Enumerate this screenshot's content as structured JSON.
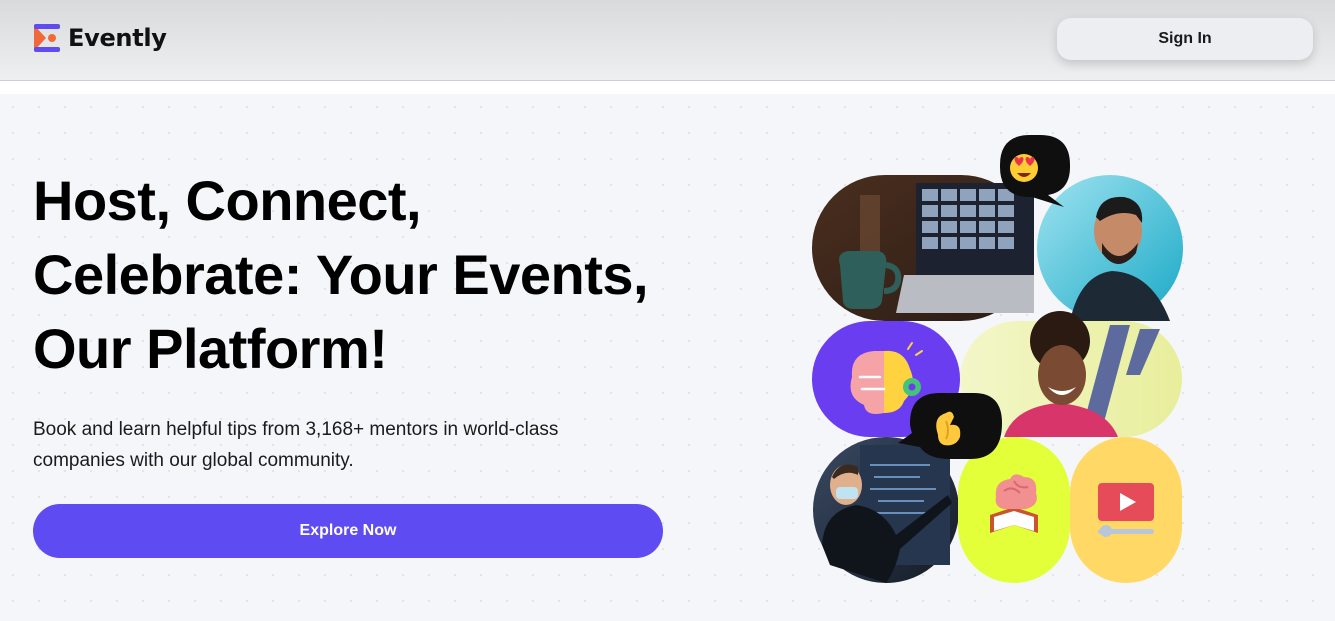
{
  "header": {
    "brand": "Evently",
    "sign_in_label": "Sign In"
  },
  "hero": {
    "headline_line1": "Host, Connect,",
    "headline_line2": "Celebrate: Your Events,",
    "headline_line3": "Our Platform!",
    "subtext_line1": "Book and learn helpful tips from 3,168+ mentors in world-class",
    "subtext_line2": "companies with our global community.",
    "cta_label": "Explore Now"
  },
  "colors": {
    "accent": "#5e4bf1",
    "logo_orange": "#f0693a",
    "logo_purple": "#5e4bf1",
    "tile_purple": "#6a3df0",
    "tile_lime": "#e2ff3a",
    "tile_yellow": "#ffd866",
    "tile_cyan": "#2cc0d6"
  },
  "collage": {
    "tiles": [
      "laptop-video-call-photo",
      "smiling-man-photo",
      "brain-lightbulb-icon",
      "laughing-woman-photo",
      "presenter-with-mask-photo",
      "brain-book-icon",
      "video-play-icon"
    ],
    "bubbles": [
      "heart-eyes-emoji",
      "pinched-fingers-emoji"
    ]
  }
}
